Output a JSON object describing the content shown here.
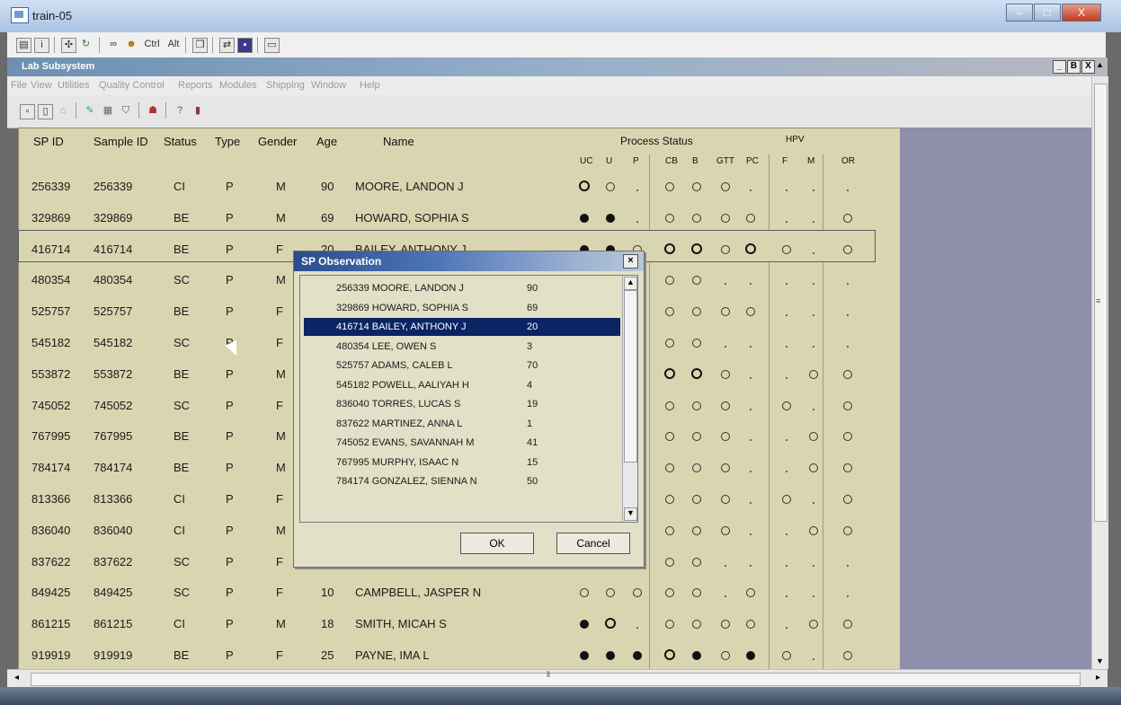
{
  "window": {
    "title": "train-05",
    "controls": [
      "–",
      "□",
      "X"
    ]
  },
  "mdi": {
    "title": "Lab Subsystem",
    "controls": [
      "_",
      "B",
      "X"
    ]
  },
  "menu": [
    "File",
    "View",
    "Utilities",
    "Quality Control",
    "Reports",
    "Modules",
    "Shipping",
    "Window",
    "Help"
  ],
  "toolbar1": {
    "ctrl": "Ctrl",
    "alt": "Alt"
  },
  "table": {
    "headers": {
      "sp_id": "SP ID",
      "sample_id": "Sample ID",
      "status": "Status",
      "type": "Type",
      "gender": "Gender",
      "age": "Age",
      "name": "Name",
      "process_status": "Process Status",
      "hpv": "HPV"
    },
    "subheaders": [
      "UC",
      "U",
      "P",
      "CB",
      "B",
      "GTT",
      "PC",
      "F",
      "M",
      "OR"
    ],
    "rows": [
      {
        "sp": "256339",
        "sample": "256339",
        "status": "CI",
        "type": "P",
        "gender": "M",
        "age": "90",
        "name": "MOORE, LANDON J",
        "marks": [
          "ob",
          "o",
          "d",
          "o",
          "o",
          "o",
          "d",
          "d",
          "d",
          "d"
        ]
      },
      {
        "sp": "329869",
        "sample": "329869",
        "status": "BE",
        "type": "P",
        "gender": "M",
        "age": "69",
        "name": "HOWARD, SOPHIA S",
        "marks": [
          "f",
          "f",
          "d",
          "o",
          "o",
          "o",
          "o",
          "d",
          "d",
          "o"
        ]
      },
      {
        "sp": "416714",
        "sample": "416714",
        "status": "BE",
        "type": "P",
        "gender": "F",
        "age": "20",
        "name": "BAILEY, ANTHONY J",
        "marks": [
          "f",
          "f",
          "o",
          "ob",
          "ob",
          "o",
          "ob",
          "o",
          "d",
          "o"
        ]
      },
      {
        "sp": "480354",
        "sample": "480354",
        "status": "SC",
        "type": "P",
        "gender": "M",
        "age": "",
        "name": "",
        "marks": [
          "",
          "",
          "",
          "o",
          "o",
          "d",
          "d",
          "d",
          "d",
          "d"
        ]
      },
      {
        "sp": "525757",
        "sample": "525757",
        "status": "BE",
        "type": "P",
        "gender": "F",
        "age": "",
        "name": "",
        "marks": [
          "",
          "",
          "",
          "o",
          "o",
          "o",
          "o",
          "d",
          "d",
          "d"
        ]
      },
      {
        "sp": "545182",
        "sample": "545182",
        "status": "SC",
        "type": "P",
        "gender": "F",
        "age": "",
        "name": "",
        "marks": [
          "",
          "",
          "",
          "o",
          "o",
          "d",
          "d",
          "d",
          "d",
          "d"
        ]
      },
      {
        "sp": "553872",
        "sample": "553872",
        "status": "BE",
        "type": "P",
        "gender": "M",
        "age": "",
        "name": "",
        "marks": [
          "",
          "",
          "",
          "ob",
          "ob",
          "o",
          "d",
          "d",
          "o",
          "o"
        ]
      },
      {
        "sp": "745052",
        "sample": "745052",
        "status": "SC",
        "type": "P",
        "gender": "F",
        "age": "",
        "name": "",
        "marks": [
          "",
          "",
          "",
          "o",
          "o",
          "o",
          "d",
          "o",
          "d",
          "o"
        ]
      },
      {
        "sp": "767995",
        "sample": "767995",
        "status": "BE",
        "type": "P",
        "gender": "M",
        "age": "",
        "name": "",
        "marks": [
          "",
          "",
          "",
          "o",
          "o",
          "o",
          "d",
          "d",
          "o",
          "o"
        ]
      },
      {
        "sp": "784174",
        "sample": "784174",
        "status": "BE",
        "type": "P",
        "gender": "M",
        "age": "",
        "name": "",
        "marks": [
          "",
          "",
          "",
          "o",
          "o",
          "o",
          "d",
          "d",
          "o",
          "o"
        ]
      },
      {
        "sp": "813366",
        "sample": "813366",
        "status": "CI",
        "type": "P",
        "gender": "F",
        "age": "",
        "name": "",
        "marks": [
          "",
          "",
          "",
          "o",
          "o",
          "o",
          "d",
          "o",
          "d",
          "o"
        ]
      },
      {
        "sp": "836040",
        "sample": "836040",
        "status": "CI",
        "type": "P",
        "gender": "M",
        "age": "",
        "name": "",
        "marks": [
          "",
          "",
          "",
          "o",
          "o",
          "o",
          "d",
          "d",
          "o",
          "o"
        ]
      },
      {
        "sp": "837622",
        "sample": "837622",
        "status": "SC",
        "type": "P",
        "gender": "F",
        "age": "",
        "name": "",
        "marks": [
          "",
          "",
          "",
          "o",
          "o",
          "d",
          "d",
          "d",
          "d",
          "d"
        ]
      },
      {
        "sp": "849425",
        "sample": "849425",
        "status": "SC",
        "type": "P",
        "gender": "F",
        "age": "10",
        "name": "CAMPBELL, JASPER N",
        "marks": [
          "o",
          "o",
          "o",
          "o",
          "o",
          "d",
          "o",
          "d",
          "d",
          "d"
        ]
      },
      {
        "sp": "861215",
        "sample": "861215",
        "status": "CI",
        "type": "P",
        "gender": "M",
        "age": "18",
        "name": "SMITH, MICAH S",
        "marks": [
          "f",
          "ob",
          "d",
          "o",
          "o",
          "o",
          "o",
          "d",
          "o",
          "o"
        ]
      },
      {
        "sp": "919919",
        "sample": "919919",
        "status": "BE",
        "type": "P",
        "gender": "F",
        "age": "25",
        "name": "PAYNE, IMA L",
        "marks": [
          "f",
          "f",
          "f",
          "ob",
          "f",
          "o",
          "f",
          "o",
          "d",
          "o"
        ]
      }
    ]
  },
  "dialog": {
    "title": "SP Observation",
    "items": [
      {
        "text": "256339 MOORE, LANDON J",
        "age": "90"
      },
      {
        "text": "329869 HOWARD, SOPHIA S",
        "age": "69"
      },
      {
        "text": "416714 BAILEY, ANTHONY J",
        "age": "20"
      },
      {
        "text": "480354 LEE, OWEN S",
        "age": "3"
      },
      {
        "text": "525757 ADAMS, CALEB L",
        "age": "70"
      },
      {
        "text": "545182 POWELL, AALIYAH H",
        "age": "4"
      },
      {
        "text": "836040 TORRES, LUCAS S",
        "age": "19"
      },
      {
        "text": "837622 MARTINEZ, ANNA L",
        "age": "1"
      },
      {
        "text": "745052 EVANS, SAVANNAH M",
        "age": "41"
      },
      {
        "text": "767995 MURPHY, ISAAC N",
        "age": "15"
      },
      {
        "text": "784174 GONZALEZ, SIENNA N",
        "age": "50"
      }
    ],
    "selected_index": 2,
    "ok_label": "OK",
    "cancel_label": "Cancel"
  }
}
